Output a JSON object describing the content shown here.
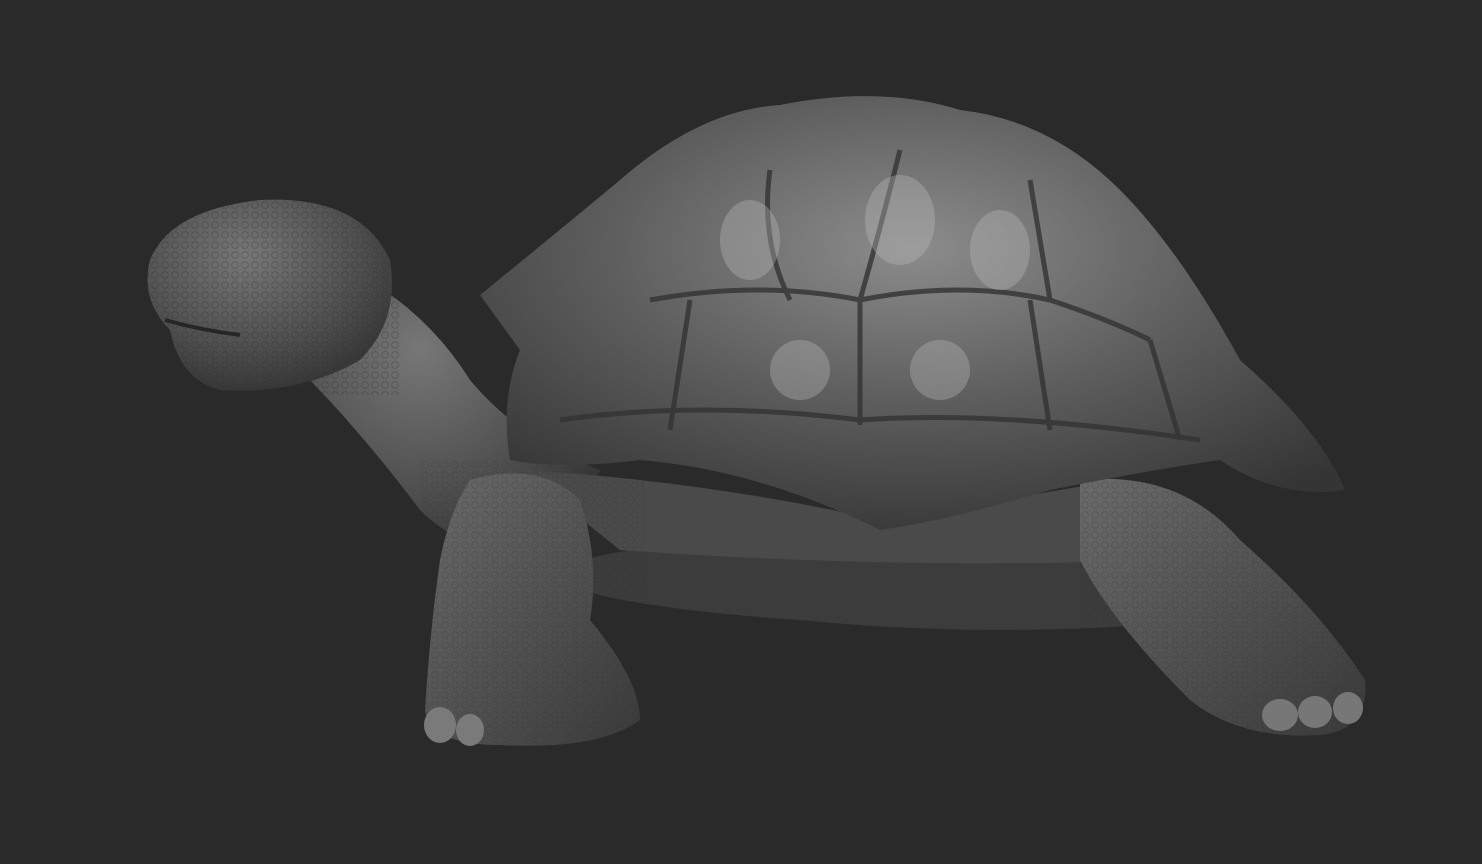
{
  "scene": {
    "subject": "tortoise-sculpt",
    "colors": {
      "background": "#2a2a2b",
      "clay_light": "#8a8a8a",
      "clay_mid": "#5a5a5a",
      "clay_dark": "#2f2f2f",
      "highlight": "#c8c8c8"
    }
  }
}
